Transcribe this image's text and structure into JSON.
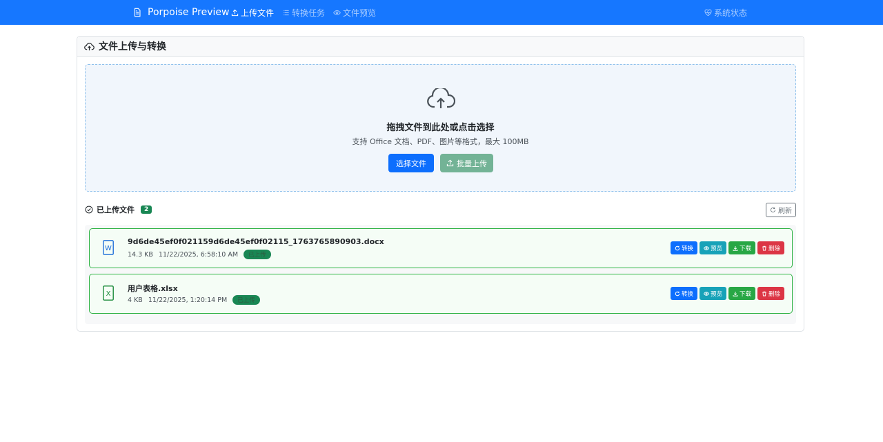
{
  "nav": {
    "brand": "Porpoise Preview",
    "links": [
      {
        "label": "上传文件",
        "icon": "upload-icon",
        "active": true
      },
      {
        "label": "转换任务",
        "icon": "list-icon",
        "active": false
      },
      {
        "label": "文件预览",
        "icon": "eye-icon",
        "active": false
      }
    ],
    "status_label": "系统状态"
  },
  "card": {
    "title": "文件上传与转换"
  },
  "dropzone": {
    "title": "拖拽文件到此处或点击选择",
    "subtitle": "支持 Office 文档、PDF、图片等格式，最大 100MB",
    "select_label": "选择文件",
    "batch_label": "批量上传"
  },
  "uploaded": {
    "title": "已上传文件",
    "count": "2",
    "refresh_label": "刷新"
  },
  "files": [
    {
      "name": "9d6de45ef0f021159d6de45ef0f02115_1763765890903.docx",
      "size": "14.3 KB",
      "time": "11/22/2025, 6:58:10 AM",
      "status": "已上传",
      "type": "W",
      "color": "#1e6fd9"
    },
    {
      "name": "用户表格.xlsx",
      "size": "4 KB",
      "time": "11/22/2025, 1:20:14 PM",
      "status": "已上传",
      "type": "X",
      "color": "#1a8a3a"
    }
  ],
  "actions": {
    "convert": "转换",
    "preview": "预览",
    "download": "下载",
    "delete": "删除"
  },
  "colors": {
    "primary": "#1677ff",
    "success": "#198754",
    "info": "#17a2b8",
    "danger": "#dc3545"
  }
}
